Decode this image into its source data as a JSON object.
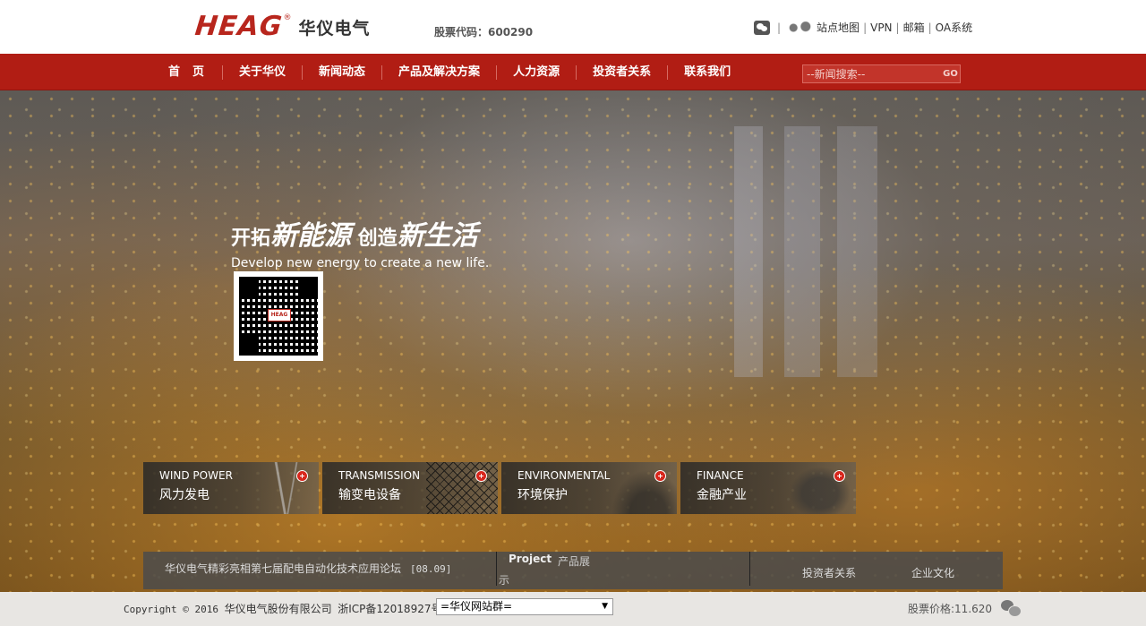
{
  "header": {
    "logo_text": "HEAG",
    "logo_reg": "®",
    "logo_cn": "华仪电气",
    "stock_code": "股票代码：600290",
    "links": [
      {
        "label": "站点地图"
      },
      {
        "label": "VPN"
      },
      {
        "label": "邮箱"
      },
      {
        "label": "OA系统"
      }
    ],
    "separator": "|"
  },
  "nav": {
    "items": [
      {
        "label": "首页"
      },
      {
        "label": "关于华仪"
      },
      {
        "label": "新闻动态"
      },
      {
        "label": "产品及解决方案"
      },
      {
        "label": "人力资源"
      },
      {
        "label": "投资者关系"
      },
      {
        "label": "联系我们"
      }
    ],
    "search_placeholder": "--新闻搜索--",
    "search_button": "GO"
  },
  "hero": {
    "slogan_part1": "开拓",
    "slogan_big1": "新能源",
    "slogan_part2": " 创造",
    "slogan_big2": "新生活",
    "slogan_en": "Develop new energy to create a new life.",
    "qr_logo": "HEAG"
  },
  "cards": [
    {
      "en": "WIND POWER",
      "cn": "风力发电",
      "icon": "plus-icon"
    },
    {
      "en": "TRANSMISSION",
      "cn": "输变电设备",
      "icon": "plus-icon"
    },
    {
      "en": "ENVIRONMENTAL",
      "cn": "环境保护",
      "icon": "plus-icon"
    },
    {
      "en": "FINANCE",
      "cn": "金融产业",
      "icon": "plus-icon"
    }
  ],
  "infobar": {
    "news_title": "华仪电气精彩亮相第七届配电自动化技术应用论坛",
    "news_date": "[08.09]",
    "project_en": "Project",
    "project_cn_a": "产品展",
    "project_cn_b": "示",
    "link_investor": "投资者关系",
    "link_culture": "企业文化"
  },
  "footer": {
    "copyright_prefix": "Copyright © 2016",
    "company": "华仪电气股份有限公司",
    "icp": "浙ICP备12018927号",
    "site_group": "=华仪网站群=",
    "stock_price": "股票价格:11.620"
  },
  "colors": {
    "brand_red": "#b11d14",
    "logo_red": "#b8261d"
  }
}
